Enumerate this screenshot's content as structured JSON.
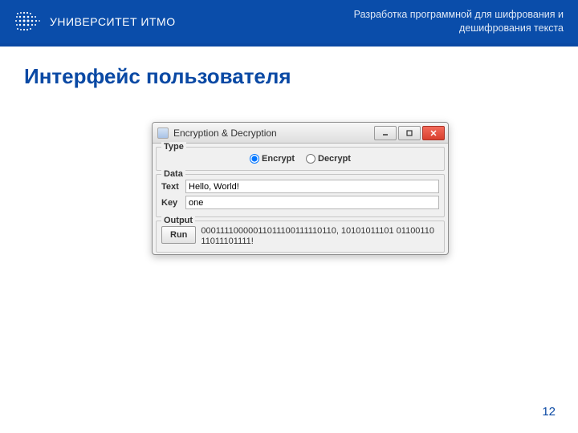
{
  "header": {
    "university": "УНИВЕРСИТЕТ ИТМО",
    "project_line1": "Разработка программной для шифрования и",
    "project_line2": "дешифрования текста"
  },
  "title": "Интерфейс пользователя",
  "window": {
    "title": "Encryption & Decryption",
    "groups": {
      "type": {
        "label": "Type",
        "options": [
          "Encrypt",
          "Decrypt"
        ]
      },
      "data": {
        "label": "Data",
        "text_label": "Text",
        "text_value": "Hello, World!",
        "key_label": "Key",
        "key_value": "one"
      },
      "output": {
        "label": "Output",
        "run_label": "Run",
        "value": "00011110000011011100111110110, 10101011101 0110011011011101111!"
      }
    }
  },
  "page_number": "12"
}
